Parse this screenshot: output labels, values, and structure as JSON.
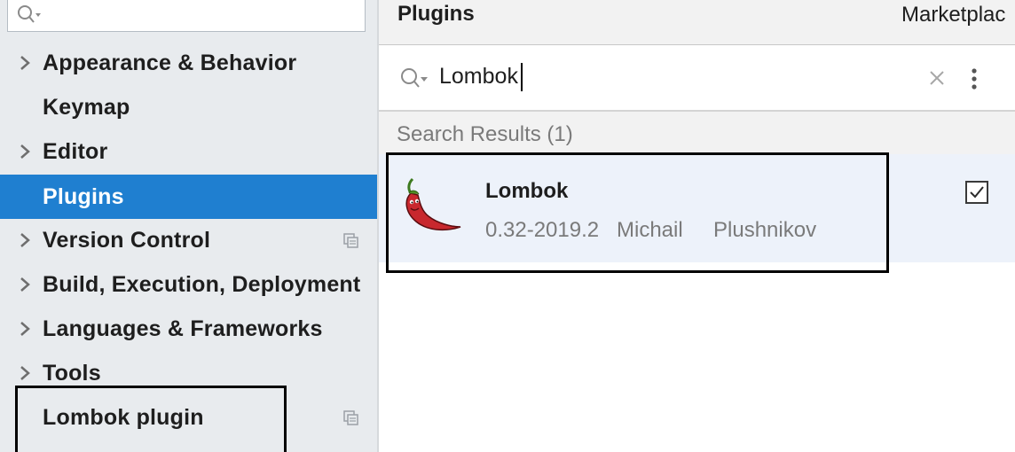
{
  "sidebar": {
    "search": {
      "value": ""
    },
    "items": [
      {
        "label": "Appearance & Behavior",
        "expandable": true,
        "selected": false,
        "has_copy_icon": false
      },
      {
        "label": "Keymap",
        "expandable": false,
        "selected": false,
        "has_copy_icon": false
      },
      {
        "label": "Editor",
        "expandable": true,
        "selected": false,
        "has_copy_icon": false
      },
      {
        "label": "Plugins",
        "expandable": false,
        "selected": true,
        "has_copy_icon": false
      },
      {
        "label": "Version Control",
        "expandable": true,
        "selected": false,
        "has_copy_icon": true
      },
      {
        "label": "Build, Execution, Deployment",
        "expandable": true,
        "selected": false,
        "has_copy_icon": false
      },
      {
        "label": "Languages & Frameworks",
        "expandable": true,
        "selected": false,
        "has_copy_icon": false
      },
      {
        "label": "Tools",
        "expandable": true,
        "selected": false,
        "has_copy_icon": false
      },
      {
        "label": "Lombok plugin",
        "expandable": false,
        "selected": false,
        "has_copy_icon": true
      }
    ]
  },
  "header": {
    "title": "Plugins",
    "tab_marketplace": "Marketplac"
  },
  "search": {
    "value": "Lombok"
  },
  "results": {
    "header": "Search Results (1)",
    "items": [
      {
        "name": "Lombok",
        "version": "0.32-2019.2",
        "vendor_first": "Michail",
        "vendor_last": "Plushnikov",
        "installed": true,
        "icon": "chili-pepper-icon"
      }
    ]
  },
  "colors": {
    "sidebar_bg": "#e8ebee",
    "selected_bg": "#1f7fd0",
    "result_bg": "#edf2fa",
    "secondary_text": "#7a7a7a"
  }
}
